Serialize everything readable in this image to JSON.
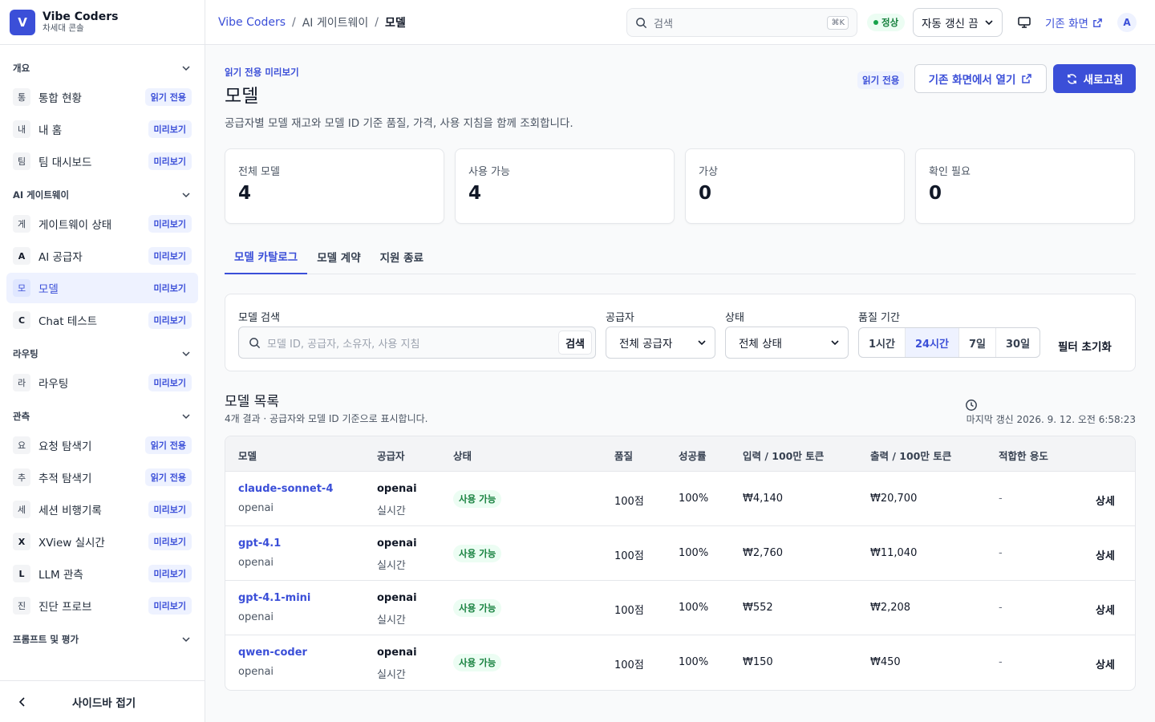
{
  "brand": {
    "initial": "V",
    "name": "Vibe Coders",
    "sub": "차세대 콘솔"
  },
  "sidebar": {
    "sections": [
      {
        "title": "개요",
        "items": [
          {
            "icon": "통",
            "label": "통합 현황",
            "badge": "읽기 전용"
          },
          {
            "icon": "내",
            "label": "내 홈",
            "badge": "미리보기"
          },
          {
            "icon": "팀",
            "label": "팀 대시보드",
            "badge": "미리보기"
          }
        ]
      },
      {
        "title": "AI 게이트웨이",
        "items": [
          {
            "icon": "게",
            "label": "게이트웨이 상태",
            "badge": "미리보기"
          },
          {
            "icon": "A",
            "label": "AI 공급자",
            "badge": "미리보기"
          },
          {
            "icon": "모",
            "label": "모델",
            "badge": "미리보기"
          },
          {
            "icon": "C",
            "label": "Chat 테스트",
            "badge": "미리보기"
          }
        ]
      },
      {
        "title": "라우팅",
        "items": [
          {
            "icon": "라",
            "label": "라우팅",
            "badge": "미리보기"
          }
        ]
      },
      {
        "title": "관측",
        "items": [
          {
            "icon": "요",
            "label": "요청 탐색기",
            "badge": "읽기 전용"
          },
          {
            "icon": "추",
            "label": "추적 탐색기",
            "badge": "읽기 전용"
          },
          {
            "icon": "세",
            "label": "세션 비행기록",
            "badge": "미리보기"
          },
          {
            "icon": "X",
            "label": "XView 실시간",
            "badge": "미리보기"
          },
          {
            "icon": "L",
            "label": "LLM 관측",
            "badge": "미리보기"
          },
          {
            "icon": "진",
            "label": "진단 프로브",
            "badge": "미리보기"
          }
        ]
      },
      {
        "title": "프롬프트 및 평가",
        "items": []
      }
    ],
    "collapse_label": "사이드바 접기"
  },
  "topbar": {
    "breadcrumb": [
      "Vibe Coders",
      "AI 게이트웨이",
      "모델"
    ],
    "search_placeholder": "검색",
    "search_shortcut": "⌘K",
    "status": "정상",
    "refresh": "자동 갱신 끔",
    "legacy_link": "기존 화면",
    "avatar": "A"
  },
  "page": {
    "eyebrow": "읽기 전용 미리보기",
    "title": "모델",
    "description": "공급자별 모델 재고와 모델 ID 기준 품질, 가격, 사용 지침을 함께 조회합니다.",
    "readonly_badge": "읽기 전용",
    "open_legacy": "기존 화면에서 열기",
    "refresh": "새로고침"
  },
  "stats": [
    {
      "label": "전체 모델",
      "value": "4"
    },
    {
      "label": "사용 가능",
      "value": "4"
    },
    {
      "label": "가상",
      "value": "0"
    },
    {
      "label": "확인 필요",
      "value": "0"
    }
  ],
  "tabs": [
    "모델 카탈로그",
    "모델 계약",
    "지원 종료"
  ],
  "filters": {
    "search_label": "모델 검색",
    "search_placeholder": "모델 ID, 공급자, 소유자, 사용 지침",
    "search_button": "검색",
    "provider_label": "공급자",
    "provider_value": "전체 공급자",
    "status_label": "상태",
    "status_value": "전체 상태",
    "period_label": "품질 기간",
    "periods": [
      "1시간",
      "24시간",
      "7일",
      "30일"
    ],
    "period_selected": "24시간",
    "reset": "필터 초기화"
  },
  "list": {
    "title": "모델 목록",
    "subtitle": "4개 결과 · 공급자와 모델 ID 기준으로 표시합니다.",
    "updated": "마지막 갱신 2026. 9. 12. 오전 6:58:23",
    "headers": [
      "모델",
      "공급자",
      "상태",
      "품질",
      "성공률",
      "입력 / 100만 토큰",
      "출력 / 100만 토큰",
      "적합한 용도"
    ],
    "rows": [
      {
        "model": "claude-sonnet-4",
        "owner": "openai",
        "provider": "openai",
        "mode": "실시간",
        "status": "사용 가능",
        "quality": "100점",
        "success": "100%",
        "input": "₩4,140",
        "output": "₩20,700",
        "use": "-",
        "action": "상세"
      },
      {
        "model": "gpt-4.1",
        "owner": "openai",
        "provider": "openai",
        "mode": "실시간",
        "status": "사용 가능",
        "quality": "100점",
        "success": "100%",
        "input": "₩2,760",
        "output": "₩11,040",
        "use": "-",
        "action": "상세"
      },
      {
        "model": "gpt-4.1-mini",
        "owner": "openai",
        "provider": "openai",
        "mode": "실시간",
        "status": "사용 가능",
        "quality": "100점",
        "success": "100%",
        "input": "₩552",
        "output": "₩2,208",
        "use": "-",
        "action": "상세"
      },
      {
        "model": "qwen-coder",
        "owner": "openai",
        "provider": "openai",
        "mode": "실시간",
        "status": "사용 가능",
        "quality": "100점",
        "success": "100%",
        "input": "₩150",
        "output": "₩450",
        "use": "-",
        "action": "상세"
      }
    ]
  },
  "colors": {
    "accent": "#3b4fd8",
    "success": "#15803d",
    "accent_soft": "#eef2ff"
  }
}
